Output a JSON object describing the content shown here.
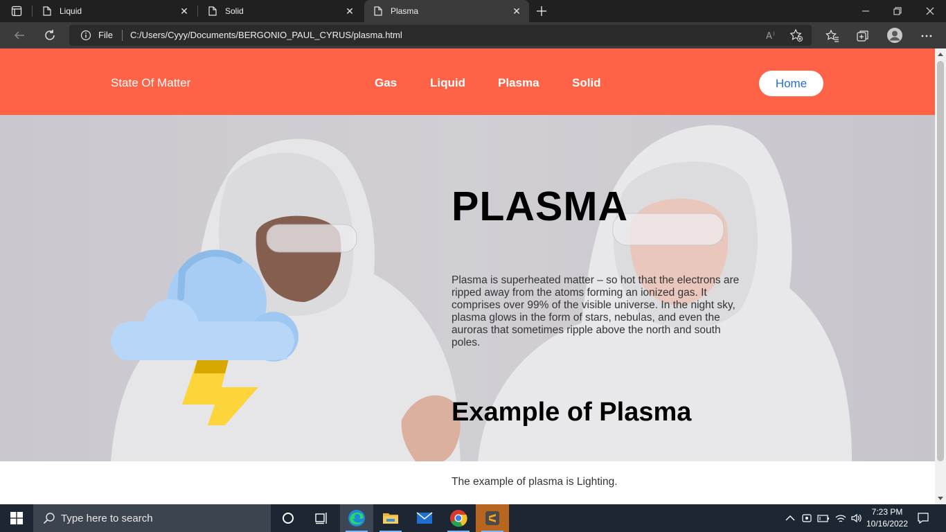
{
  "browser": {
    "tabs": [
      {
        "title": "Liquid",
        "active": false
      },
      {
        "title": "Solid",
        "active": false
      },
      {
        "title": "Plasma",
        "active": true
      }
    ],
    "address": {
      "scheme_label": "File",
      "url": "C:/Users/Cyyy/Documents/BERGONIO_PAUL_CYRUS/plasma.html"
    }
  },
  "page": {
    "brand": "State Of Matter",
    "nav": [
      "Gas",
      "Liquid",
      "Plasma",
      "Solid"
    ],
    "home_button": "Home",
    "hero": {
      "title": "PLASMA",
      "description": "Plasma is superheated matter – so hot that the electrons are ripped away from the atoms forming an ionized gas. It comprises over 99% of the visible universe. In the night sky, plasma glows in the form of stars, nebulas, and even the auroras that sometimes ripple above the north and south poles.",
      "subheading": "Example of Plasma"
    },
    "example_text": "The example of plasma is Lighting.",
    "icons": {
      "hero_illustration": "cloud-lightning-icon"
    },
    "colors": {
      "navbar": "#ff6347",
      "home_link": "#1f6fd6"
    }
  },
  "taskbar": {
    "search_placeholder": "Type here to search",
    "time": "7:23 PM",
    "date": "10/16/2022",
    "apps": [
      "task-view-icon",
      "edge-icon",
      "file-explorer-icon",
      "mail-icon",
      "chrome-icon",
      "sublime-text-icon"
    ]
  }
}
